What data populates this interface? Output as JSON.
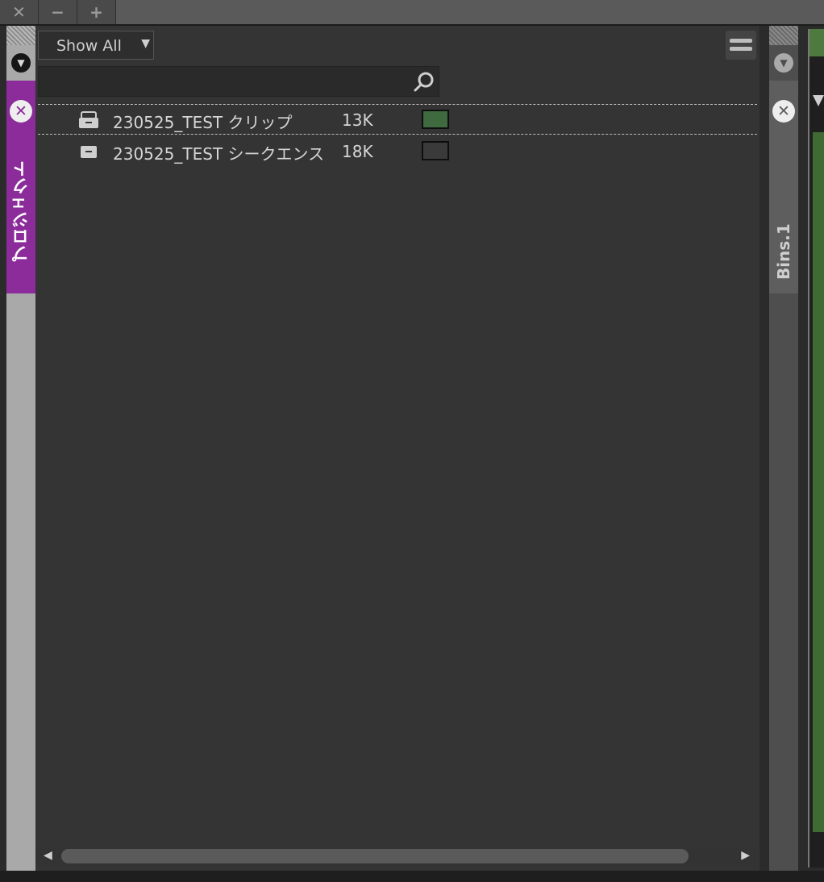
{
  "window_controls": {
    "close": "✕",
    "minimize": "−",
    "maximize": "+"
  },
  "left_tab": {
    "label": "プロジェクト",
    "accent": "#8b2c9a"
  },
  "toolbar": {
    "filter_value": "Show All"
  },
  "search": {
    "value": "",
    "placeholder": ""
  },
  "items": [
    {
      "name": "230525_TEST クリップ",
      "size": "13K",
      "color": "#3f6a3f",
      "icon": "bin-icon",
      "selected": true
    },
    {
      "name": "230525_TEST シークエンス",
      "size": "18K",
      "color": "#3a3a3a",
      "icon": "bin-icon",
      "selected": false
    }
  ],
  "right_tab": {
    "label": "Bins.1"
  }
}
